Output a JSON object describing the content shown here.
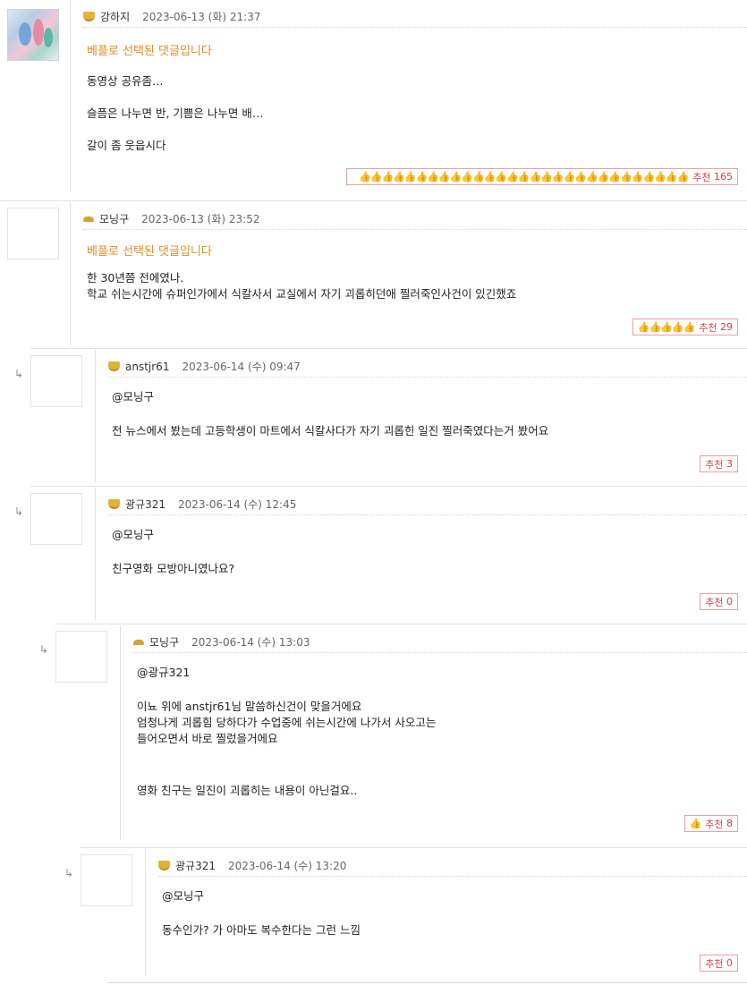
{
  "colors": {
    "best": "#e48a27",
    "recommend": "#d64040",
    "border": "#e2e2e2"
  },
  "reply_arrow": "↳",
  "best_label": "베플로 선택된 댓글입니다",
  "rec_label": "추천",
  "comments": [
    {
      "name": "강하지",
      "date": "2023-06-13 (화) 21:37",
      "best": true,
      "lines": [
        "동영상 공유좀…",
        "슬픔은 나누면 반, 기쁨은 나누면 배…",
        "갈이 좀 웃읍시다"
      ],
      "thumbs": "👍👍👍👍👍👍👍👍👍👍👍👍👍👍👍👍👍👍👍👍👍👍👍👍👍👍👍👍👍",
      "rec": "165"
    },
    {
      "name": "모닝구",
      "date": "2023-06-13 (화) 23:52",
      "best": true,
      "lines": [
        "한 30년쯤 전에였나.",
        "학교 쉬는시간에 슈퍼인가에서 식칼사서 교실에서 자기 괴롭히던애 찔러죽인사건이 있긴했죠"
      ],
      "thumbs": "👍👍👍👍👍",
      "rec": "29"
    },
    {
      "name": "anstjr61",
      "date": "2023-06-14 (수) 09:47",
      "lines": [
        "@모닝구",
        "전 뉴스에서 봤는데 고등학생이 마트에서 식칼사다가 자기 괴롭힌 일진 찔러죽였다는거 봤어요"
      ],
      "rec": "3"
    },
    {
      "name": "광규321",
      "date": "2023-06-14 (수) 12:45",
      "lines": [
        "@모닝구",
        "친구영화 모방아니였나요?"
      ],
      "rec": "0"
    },
    {
      "name": "모닝구",
      "date": "2023-06-14 (수) 13:03",
      "lines": [
        "@광규321",
        "이뇨 위에 anstjr61님 말씀하신건이 맞을거에요",
        "엄청나게 괴롭힘 당하다가 수업중에 쉬는시간에 나가서 사오고는",
        "들어오면서 바로 찔렀을거에요",
        "영화 친구는 일진이 괴롭히는 내용이 아닌걸요.."
      ],
      "thumbs": "👍",
      "rec": "8"
    },
    {
      "name": "광규321",
      "date": "2023-06-14 (수) 13:20",
      "lines": [
        "@모닝구",
        "동수인가? 가 아마도 복수한다는 그런 느낌"
      ],
      "rec": "0"
    }
  ]
}
